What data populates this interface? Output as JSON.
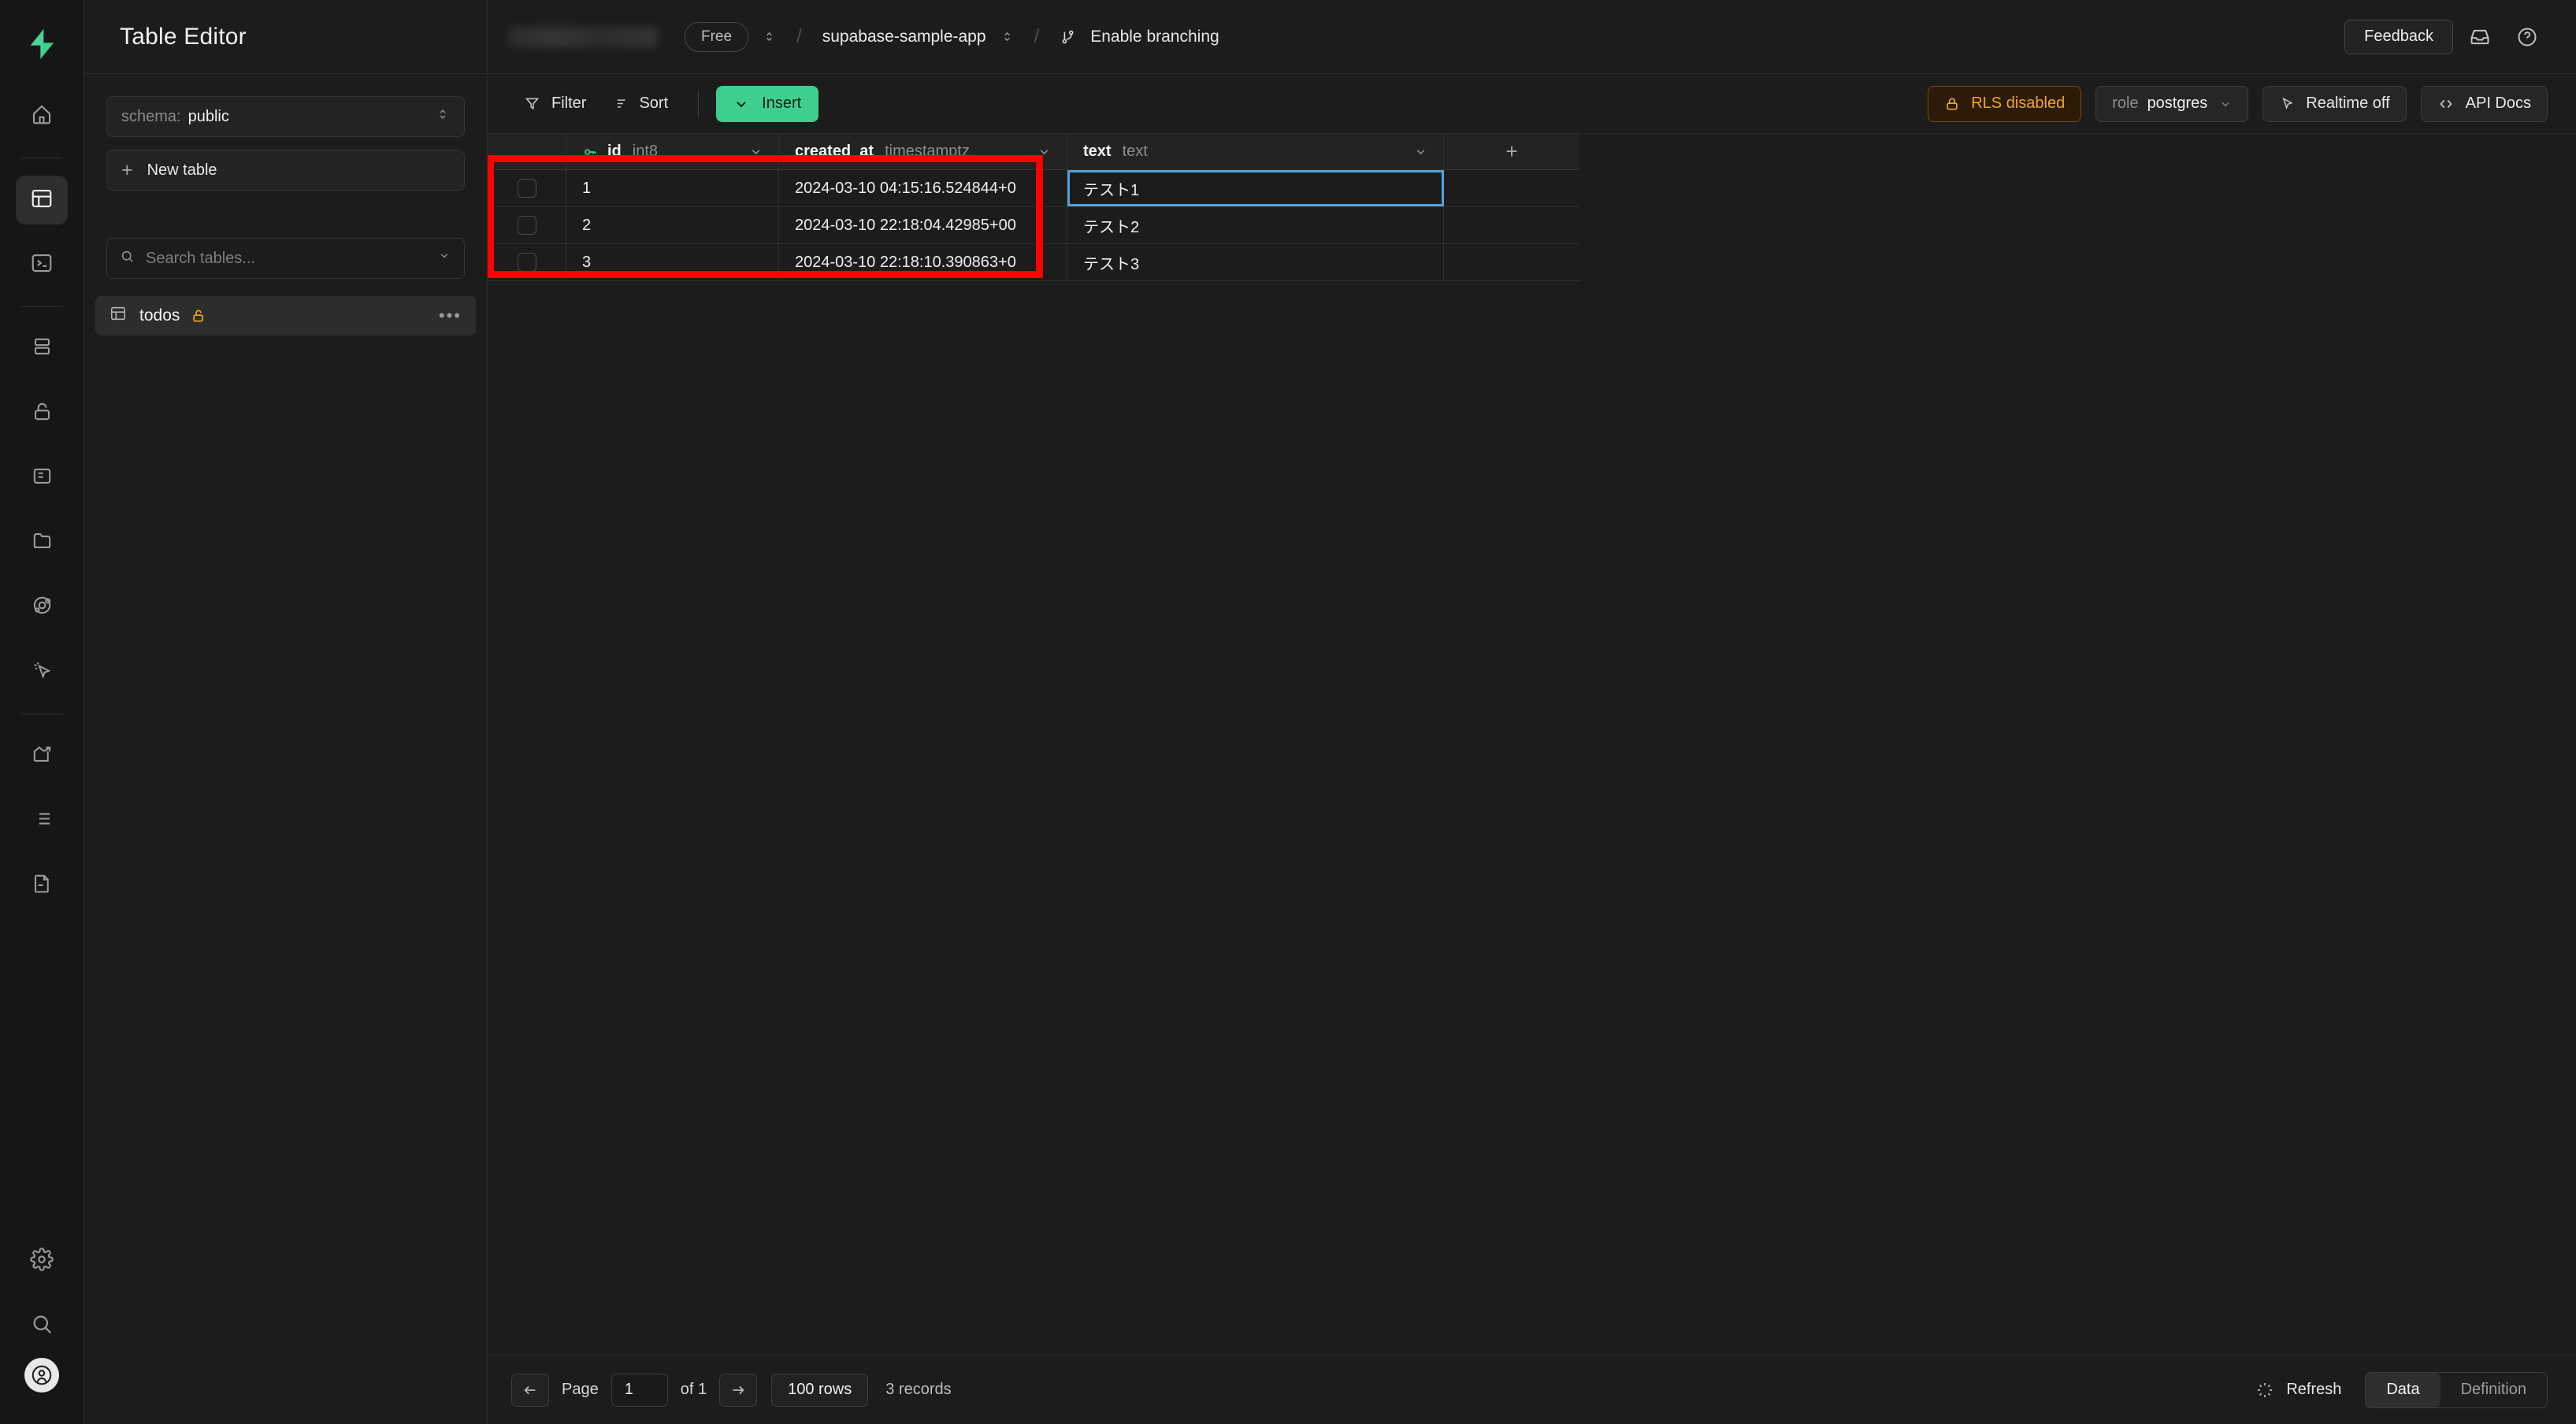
{
  "rail": {
    "logo": "supabase-logo",
    "items": [
      {
        "name": "home-icon",
        "label": "Home",
        "active": false
      },
      {
        "name": "table-editor-icon",
        "label": "Table Editor",
        "active": true
      },
      {
        "name": "sql-editor-icon",
        "label": "SQL Editor",
        "active": false
      },
      {
        "name": "database-icon",
        "label": "Database",
        "active": false
      },
      {
        "name": "auth-icon",
        "label": "Authentication",
        "active": false
      },
      {
        "name": "storage-icon",
        "label": "Storage",
        "active": false
      },
      {
        "name": "edge-functions-icon",
        "label": "Edge Functions",
        "active": false
      },
      {
        "name": "realtime-icon",
        "label": "Realtime",
        "active": false
      },
      {
        "name": "reports-icon",
        "label": "Reports",
        "active": false
      },
      {
        "name": "logs-icon",
        "label": "Logs",
        "active": false
      },
      {
        "name": "api-docs-icon",
        "label": "API Docs",
        "active": false
      },
      {
        "name": "settings-icon",
        "label": "Project Settings",
        "active": false
      },
      {
        "name": "search-icon",
        "label": "Search",
        "active": false
      }
    ]
  },
  "sidebar": {
    "title": "Table Editor",
    "schema": {
      "label": "schema:",
      "value": "public"
    },
    "new_table": "New table",
    "search_placeholder": "Search tables...",
    "tables": [
      {
        "name": "todos",
        "rls_locked": true,
        "menu": "•••"
      }
    ]
  },
  "topbar": {
    "org_redacted": true,
    "plan": "Free",
    "project": "supabase-sample-app",
    "branching": "Enable branching",
    "feedback": "Feedback",
    "inbox_icon": "inbox-icon",
    "help_icon": "help-icon",
    "separator": "/"
  },
  "toolbar": {
    "filter": "Filter",
    "sort": "Sort",
    "insert": "Insert",
    "rls": "RLS disabled",
    "role_label": "role",
    "role_value": "postgres",
    "realtime": "Realtime off",
    "api_docs": "API Docs"
  },
  "grid": {
    "columns": [
      {
        "name": "id",
        "type": "int8",
        "primary_key": true
      },
      {
        "name": "created_at",
        "type": "timestamptz",
        "primary_key": false
      },
      {
        "name": "text",
        "type": "text",
        "primary_key": false
      }
    ],
    "add_column": "+",
    "rows": [
      {
        "id": "1",
        "created_at": "2024-03-10 04:15:16.524844+0",
        "text": "テスト1",
        "selected_cell": "text"
      },
      {
        "id": "2",
        "created_at": "2024-03-10 22:18:04.42985+00",
        "text": "テスト2",
        "selected_cell": null
      },
      {
        "id": "3",
        "created_at": "2024-03-10 22:18:10.390863+0",
        "text": "テスト3",
        "selected_cell": null
      }
    ]
  },
  "annotation": {
    "color": "#ff0000",
    "shape": "rectangle"
  },
  "footer": {
    "page_label": "Page",
    "page_value": "1",
    "of_label": "of 1",
    "rows_per_page": "100 rows",
    "records": "3 records",
    "refresh": "Refresh",
    "tab_data": "Data",
    "tab_definition": "Definition"
  },
  "colors": {
    "accent_green": "#3ecf8e",
    "warning_orange": "#f5a623",
    "selection_blue": "#4ea3e0",
    "annotation_red": "#ff0000",
    "bg": "#1c1c1c"
  }
}
